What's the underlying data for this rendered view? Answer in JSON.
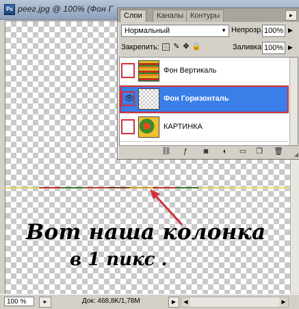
{
  "document": {
    "title": "реег.jpg @ 100% (Фон Г",
    "app_icon": "Ps"
  },
  "caption": {
    "line1": "Вот наша колонка",
    "line2": "в 1 пикс ."
  },
  "statusbar": {
    "zoom": "100 %",
    "doc_size": "Док: 468,8K/1,78M",
    "nav_icon": "▸",
    "arrow_icon": "▶"
  },
  "layers_panel": {
    "tabs": [
      "Слои",
      "Каналы",
      "Контуры"
    ],
    "menu_icon": "►",
    "blend_mode": "Нормальный",
    "opacity_label": "Непрозр.:",
    "opacity_value": "100%",
    "lock_label": "Закрепить:",
    "fill_label": "Заливка:",
    "fill_value": "100%",
    "layers": [
      {
        "name": "Фон Вертикаль",
        "visible": false,
        "selected": false
      },
      {
        "name": "Фон Горизонталь",
        "visible": true,
        "selected": true
      },
      {
        "name": "КАРТИНКА",
        "visible": false,
        "selected": false
      }
    ],
    "footer_icons": [
      "link-icon",
      "layer-style-icon",
      "layer-mask-icon",
      "adjustment-layer-icon",
      "new-group-icon",
      "new-layer-icon",
      "delete-layer-icon"
    ]
  },
  "colors": {
    "selection": "#3a7ee8",
    "highlight_box": "#d0303c",
    "arrow": "#d0303c"
  }
}
